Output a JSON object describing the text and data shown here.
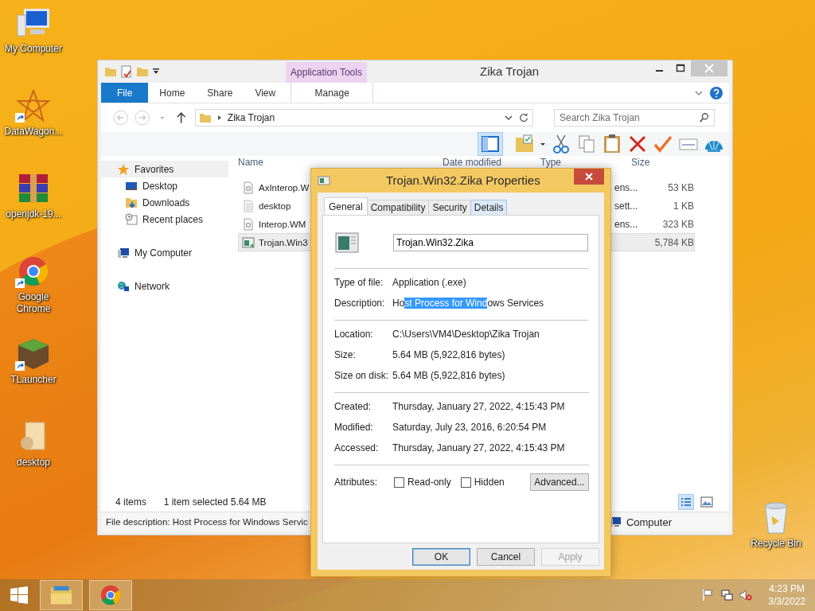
{
  "desktop_icons": [
    {
      "label": "My Computer",
      "kind": "computer",
      "shortcut": false
    },
    {
      "label": "DataWagon...",
      "kind": "star",
      "shortcut": true
    },
    {
      "label": "openjdk-19...",
      "kind": "archive",
      "shortcut": false
    },
    {
      "label": "Google Chrome",
      "kind": "chrome",
      "shortcut": true
    },
    {
      "label": "TLauncher",
      "kind": "block",
      "shortcut": true
    },
    {
      "label": "desktop",
      "kind": "file",
      "shortcut": false
    }
  ],
  "recycle_bin": {
    "label": "Recycle Bin"
  },
  "explorer": {
    "title": "Zika Trojan",
    "context_group": "Application Tools",
    "ribbon_tabs": [
      {
        "label": "File",
        "kind": "file"
      },
      {
        "label": "Home",
        "kind": "plain"
      },
      {
        "label": "Share",
        "kind": "plain"
      },
      {
        "label": "View",
        "kind": "plain"
      },
      {
        "label": "Manage",
        "kind": "context"
      }
    ],
    "address": "Zika Trojan",
    "search_placeholder": "Search Zika Trojan",
    "nav": [
      {
        "label": "Favorites",
        "kind": "star",
        "selected": true,
        "children": [
          {
            "label": "Desktop",
            "kind": "desktop",
            "selected": false
          },
          {
            "label": "Downloads",
            "kind": "downloads",
            "selected": false
          },
          {
            "label": "Recent places",
            "kind": "recent",
            "selected": false
          }
        ]
      },
      {
        "label": "My Computer",
        "kind": "computer",
        "selected": false
      },
      {
        "label": "Network",
        "kind": "network",
        "selected": false
      }
    ],
    "columns": [
      "Name",
      "Date modified",
      "Type",
      "Size"
    ],
    "files": [
      {
        "name": "AxInterop.W",
        "type": "ens...",
        "size": "53 KB",
        "kind": "dll",
        "selected": false
      },
      {
        "name": "desktop",
        "type": "sett...",
        "size": "1 KB",
        "kind": "ini",
        "selected": false
      },
      {
        "name": "Interop.WM",
        "type": "ens...",
        "size": "323 KB",
        "kind": "dll",
        "selected": false
      },
      {
        "name": "Trojan.Win3",
        "size": "5,784 KB",
        "kind": "exe",
        "selected": true
      }
    ],
    "status": {
      "items": "4 items",
      "selection": "1 item selected  5.64 MB"
    },
    "details_bar": {
      "description": "File description: Host Process for Windows Servic",
      "location": "Computer"
    }
  },
  "dialog": {
    "title": "Trojan.Win32.Zika Properties",
    "tabs": [
      {
        "label": "General",
        "selected": true
      },
      {
        "label": "Compatibility",
        "selected": false
      },
      {
        "label": "Security",
        "selected": false
      },
      {
        "label": "Details",
        "selected": false
      }
    ],
    "file_name": "Trojan.Win32.Zika",
    "sections": [
      [
        {
          "label": "Type of file:",
          "parts": [
            {
              "text": "Application (.exe)",
              "selected": false
            }
          ]
        },
        {
          "label": "Description:",
          "parts": [
            {
              "text": "Ho",
              "selected": false
            },
            {
              "text": "st Process for Wind",
              "selected": true
            },
            {
              "text": "ows Services",
              "selected": false
            }
          ]
        }
      ],
      [
        {
          "label": "Location:",
          "parts": [
            {
              "text": "C:\\Users\\VM4\\Desktop\\Zika Trojan",
              "selected": false
            }
          ]
        },
        {
          "label": "Size:",
          "parts": [
            {
              "text": "5.64 MB (5,922,816 bytes)",
              "selected": false
            }
          ]
        },
        {
          "label": "Size on disk:",
          "parts": [
            {
              "text": "5.64 MB (5,922,816 bytes)",
              "selected": false
            }
          ]
        }
      ],
      [
        {
          "label": "Created:",
          "parts": [
            {
              "text": "Thursday, January 27, 2022, 4:15:43 PM",
              "selected": false
            }
          ]
        },
        {
          "label": "Modified:",
          "parts": [
            {
              "text": "Saturday, July 23, 2016, 6:20:54 PM",
              "selected": false
            }
          ]
        },
        {
          "label": "Accessed:",
          "parts": [
            {
              "text": "Thursday, January 27, 2022, 4:15:43 PM",
              "selected": false
            }
          ]
        }
      ]
    ],
    "attributes": {
      "label": "Attributes:",
      "checkboxes": [
        {
          "label": "Read-only",
          "checked": false
        },
        {
          "label": "Hidden",
          "checked": false
        }
      ],
      "advanced": "Advanced..."
    },
    "buttons": [
      {
        "label": "OK",
        "default": true,
        "disabled": false
      },
      {
        "label": "Cancel",
        "default": false,
        "disabled": false
      },
      {
        "label": "Apply",
        "default": false,
        "disabled": true
      }
    ]
  },
  "taskbar": {
    "apps": [
      {
        "kind": "explorer"
      },
      {
        "kind": "chrome"
      }
    ],
    "time": "4:23 PM",
    "date": "3/3/2022"
  }
}
